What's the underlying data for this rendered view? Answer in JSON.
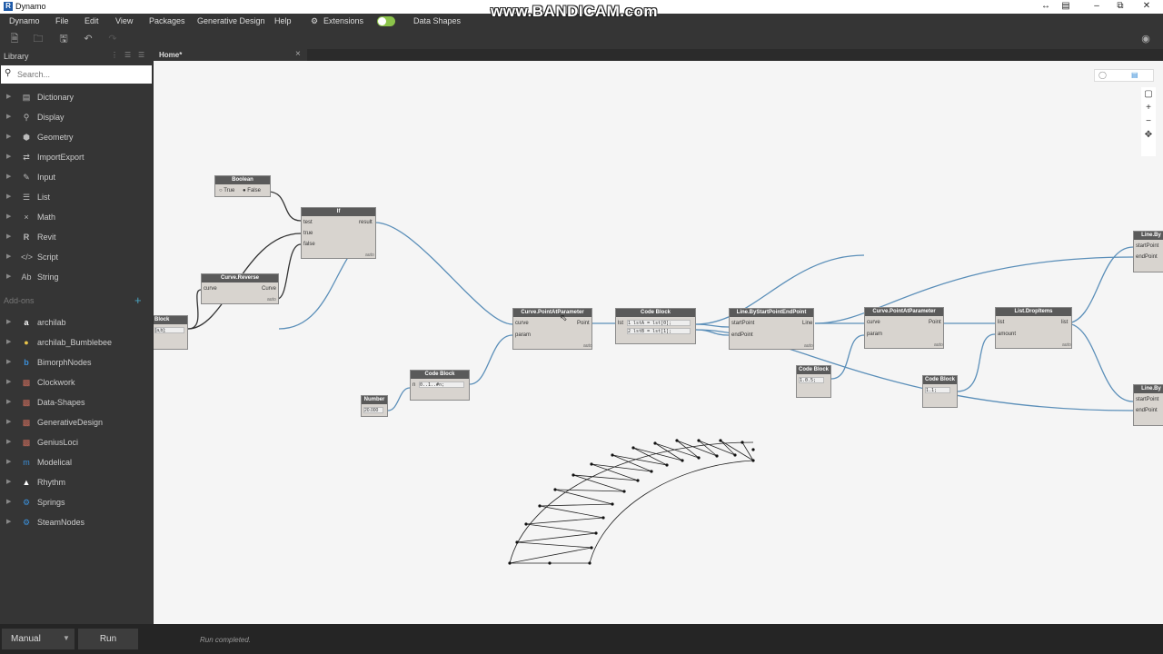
{
  "title_bar": {
    "app_title": "Dynamo",
    "app_letter": "R"
  },
  "watermark": "www.BANDICAM.com",
  "menu": {
    "items": [
      "Dynamo",
      "File",
      "Edit",
      "View",
      "Packages",
      "Generative Design",
      "Help",
      "Extensions",
      "Data Shapes"
    ]
  },
  "library": {
    "title": "Library",
    "search_placeholder": "Search...",
    "categories": [
      {
        "label": "Dictionary",
        "icon": "dictionary-icon"
      },
      {
        "label": "Display",
        "icon": "display-icon"
      },
      {
        "label": "Geometry",
        "icon": "geometry-icon"
      },
      {
        "label": "ImportExport",
        "icon": "import-export-icon"
      },
      {
        "label": "Input",
        "icon": "input-icon"
      },
      {
        "label": "List",
        "icon": "list-icon"
      },
      {
        "label": "Math",
        "icon": "math-icon"
      },
      {
        "label": "Revit",
        "icon": "revit-icon"
      },
      {
        "label": "Script",
        "icon": "script-icon"
      },
      {
        "label": "String",
        "icon": "string-icon"
      }
    ],
    "addons_title": "Add-ons",
    "addons": [
      {
        "label": "archilab"
      },
      {
        "label": "archilab_Bumblebee"
      },
      {
        "label": "BimorphNodes"
      },
      {
        "label": "Clockwork"
      },
      {
        "label": "Data-Shapes"
      },
      {
        "label": "GenerativeDesign"
      },
      {
        "label": "GeniusLoci"
      },
      {
        "label": "Modelical"
      },
      {
        "label": "Rhythm"
      },
      {
        "label": "Springs"
      },
      {
        "label": "SteamNodes"
      }
    ]
  },
  "tab": {
    "label": "Home*"
  },
  "nodes": {
    "boolean": {
      "title": "Boolean",
      "opt_true": "True",
      "opt_false": "False"
    },
    "if": {
      "title": "If",
      "in1": "test",
      "in2": "true",
      "in3": "false",
      "out": "result",
      "lacing": "auto"
    },
    "reverse": {
      "title": "Curve.Reverse",
      "in1": "curve",
      "out": "Curve",
      "lacing": "auto"
    },
    "block_left": {
      "title": "Block",
      "code": "[a,b];"
    },
    "point_at_param_1": {
      "title": "Curve.PointAtParameter",
      "in1": "curve",
      "in2": "param",
      "out": "Point",
      "lacing": "auto"
    },
    "code_block_1": {
      "title": "Code Block",
      "line1": "1 lstA = lst[0];",
      "line2": "2 lstB = lst[1];",
      "in1": "lst"
    },
    "line_by_points": {
      "title": "Line.ByStartPointEndPoint",
      "in1": "startPoint",
      "in2": "endPoint",
      "out": "Line",
      "lacing": "auto"
    },
    "point_at_param_2": {
      "title": "Curve.PointAtParameter",
      "in1": "curve",
      "in2": "param",
      "out": "Point",
      "lacing": "auto"
    },
    "drop_items": {
      "title": "List.DropItems",
      "in1": "list",
      "in2": "amount",
      "out": "list",
      "lacing": "auto"
    },
    "line_by_right_top": {
      "title": "Line.By",
      "in1": "startPoint",
      "in2": "endPoint"
    },
    "line_by_right_bottom": {
      "title": "Line.By",
      "in1": "startPoint",
      "in2": "endPoint"
    },
    "code_block_2": {
      "title": "Code Block",
      "code": "0..1..#n;",
      "in1": "n"
    },
    "number": {
      "title": "Number",
      "value": "20.000"
    },
    "code_block_3": {
      "title": "Code Block",
      "code": "1.0.5;"
    },
    "code_block_4": {
      "title": "Code Block",
      "code": "1.1;"
    }
  },
  "bottom": {
    "run_mode": "Manual",
    "run_label": "Run",
    "status": "Run completed."
  },
  "colors": {
    "wire": "#5b8fb9",
    "canvas": "#f5f5f5",
    "node_header": "#5a5a5a",
    "toggle_on": "#8bc34a"
  }
}
